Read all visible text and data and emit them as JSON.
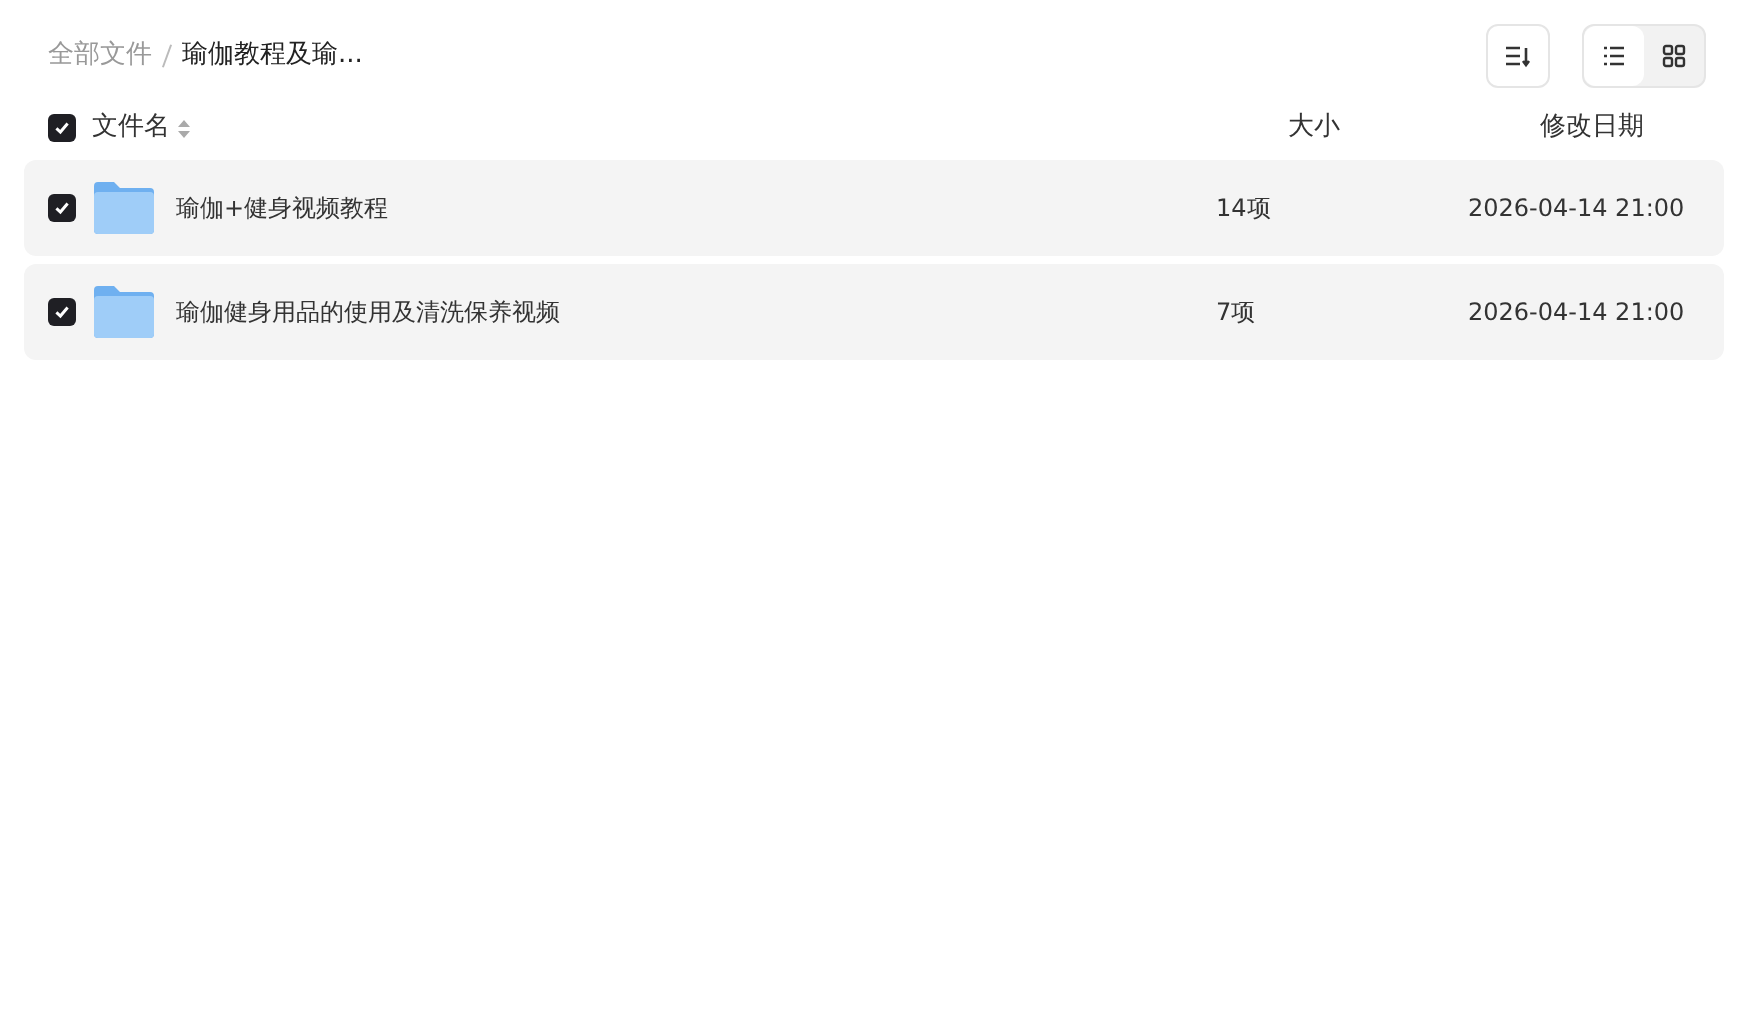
{
  "breadcrumb": [
    {
      "label": "全部文件",
      "current": false
    },
    {
      "label": "瑜伽教程及瑜...",
      "current": true
    }
  ],
  "view_modes": [
    {
      "kind": "list",
      "selected": true
    },
    {
      "kind": "grid",
      "selected": false
    }
  ],
  "header": {
    "checked": true,
    "columns": [
      "文件名",
      "大小",
      "修改日期"
    ]
  },
  "rows": [
    {
      "checked": true,
      "name": "瑜伽+健身视频教程",
      "size": "14项",
      "modified": "2026-04-14 21:00"
    },
    {
      "checked": true,
      "name": "瑜伽健身用品的使用及清洗保养视频",
      "size": "7项",
      "modified": "2026-04-14 21:00"
    }
  ]
}
